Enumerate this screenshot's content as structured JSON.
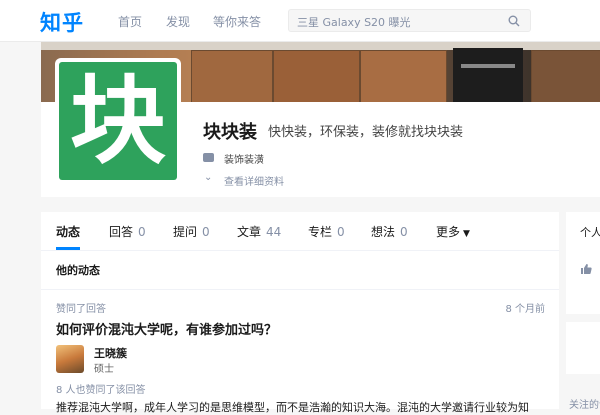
{
  "nav": {
    "logo": "知乎",
    "items": [
      {
        "label": "首页"
      },
      {
        "label": "发现"
      },
      {
        "label": "等你来答"
      }
    ],
    "search_placeholder": "三星 Galaxy S20 曝光"
  },
  "profile": {
    "avatar_glyph": "块",
    "name": "块块装",
    "headline": "快快装，环保装，装修就找块块装",
    "business": "装饰装潢",
    "more_link": "查看详细资料",
    "more_icon": "chevron-down-icon"
  },
  "tabs": [
    {
      "label": "动态",
      "count": ""
    },
    {
      "label": "回答",
      "count": "0"
    },
    {
      "label": "提问",
      "count": "0"
    },
    {
      "label": "文章",
      "count": "44"
    },
    {
      "label": "专栏",
      "count": "0"
    },
    {
      "label": "想法",
      "count": "0"
    },
    {
      "label": "更多",
      "count": ""
    }
  ],
  "feed": {
    "section_title": "他的动态",
    "item": {
      "meta": "赞同了回答",
      "time": "8 个月前",
      "question": "如何评价混沌大学呢，有谁参加过吗？",
      "author_name": "王晓簇",
      "author_title": "硕士",
      "likes": "8 人也赞同了该回答",
      "excerpt": "推荐混沌大学啊，成年人学习的是思维模型，而不是浩瀚的知识大海。混沌的大学邀请行业较为知"
    }
  },
  "sidebar": {
    "card1_label": "个人成就",
    "card3_label": "关注的话题"
  },
  "colors": {
    "brand": "#0084ff",
    "avatar_bg": "#2ea25c",
    "muted": "#8590a6"
  }
}
